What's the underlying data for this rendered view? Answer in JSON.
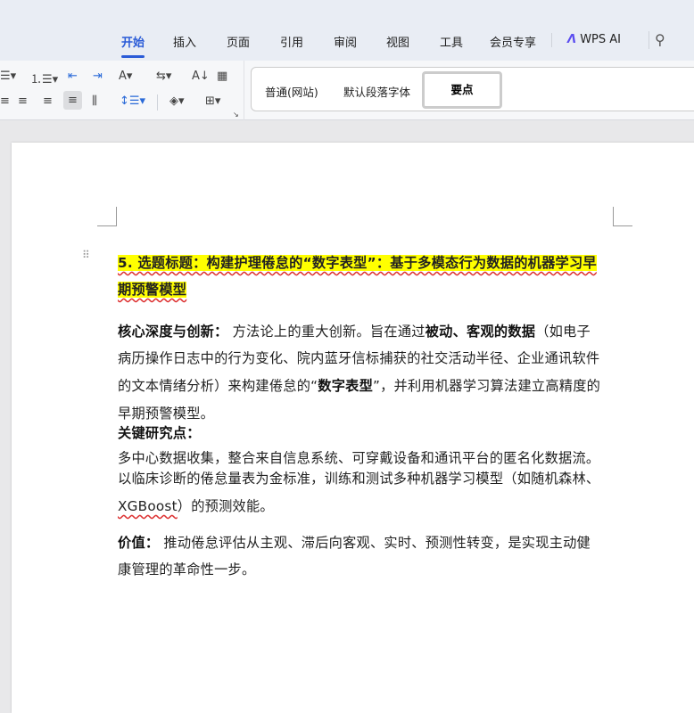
{
  "menu_tabs": [
    "开始",
    "插入",
    "页面",
    "引用",
    "审阅",
    "视图",
    "工具",
    "会员专享"
  ],
  "wps_ai": "WPS AI",
  "styles": {
    "items": [
      "普通(网站)",
      "默认段落字体"
    ],
    "selected": "要点"
  },
  "doc": {
    "lines": [
      {
        "cls": "hl",
        "segs": [
          {
            "t": "5. 选题标题：构建护理倦怠的“数字表型”：基于多模态行为数据的机器学习早"
          }
        ]
      },
      {
        "cls": "hl",
        "segs": [
          {
            "t": "期预警模型"
          }
        ]
      },
      {
        "segs": [
          {
            "t": "核心深度与创新：",
            "b": true
          },
          {
            "t": " 方法论上的重大创新。旨在通过"
          },
          {
            "t": "被动、客观的数据",
            "b": true
          },
          {
            "t": "（如电子"
          }
        ]
      },
      {
        "segs": [
          {
            "t": "病历操作日志中的行为变化、院内蓝牙信标捕获的社交活动半径、企业通讯软件"
          }
        ]
      },
      {
        "segs": [
          {
            "t": "的文本情绪分析）来构建倦怠的“"
          },
          {
            "t": "数字表型",
            "b": true
          },
          {
            "t": "”，并利用机器学习算法建立高精度的"
          }
        ]
      },
      {
        "segs": [
          {
            "t": "早期预警模型。"
          }
        ]
      },
      {
        "segs": [
          {
            "t": "关键研究点：",
            "b": true
          }
        ]
      },
      {
        "segs": [
          {
            "t": "多中心数据收集，整合来自信息系统、可穿戴设备和通讯平台的匿名化数据流。"
          }
        ]
      },
      {
        "segs": [
          {
            "t": "以临床诊断的倦怠量表为金标准，训练和测试多种机器学习模型（如随机森林、"
          }
        ]
      },
      {
        "segs": [
          {
            "t": "XGBoost",
            "s": true
          },
          {
            "t": "）的预测效能。"
          }
        ]
      },
      {
        "segs": [
          {
            "t": "价值：",
            "b": true
          },
          {
            "t": " 推动倦怠评估从主观、滞后向客观、实时、预测性转变，是实现主动健"
          }
        ]
      },
      {
        "segs": [
          {
            "t": "康管理的革命性一步。"
          }
        ]
      }
    ]
  }
}
